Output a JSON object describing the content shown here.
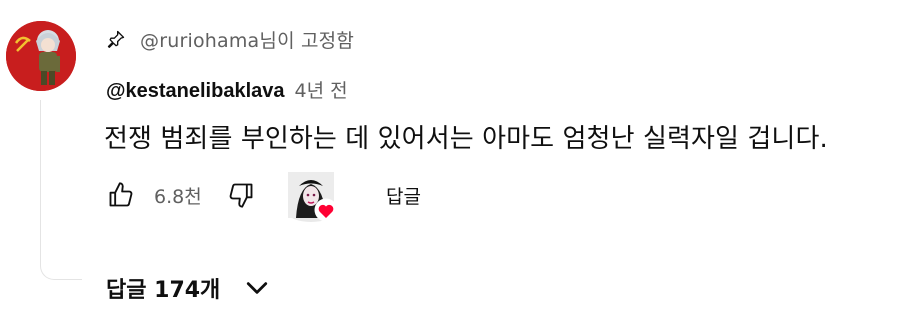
{
  "pinned": {
    "icon": "pin-icon",
    "text": "@ruriohama님이 고정함"
  },
  "comment": {
    "author": "@kestanelibaklava",
    "time": "4년 전",
    "text": "전쟁 범죄를 부인하는 데 있어서는 아마도 엄청난 실력자일 겁니다.",
    "avatar_bg": "#c81e1e"
  },
  "actions": {
    "like_icon": "thumbs-up-icon",
    "like_count": "6.8천",
    "dislike_icon": "thumbs-down-icon",
    "creator_heart_icon": "heart-icon",
    "heart_color": "#ff0033",
    "reply_label": "답글"
  },
  "replies": {
    "label": "답글 174개",
    "chevron_icon": "chevron-down-icon"
  }
}
